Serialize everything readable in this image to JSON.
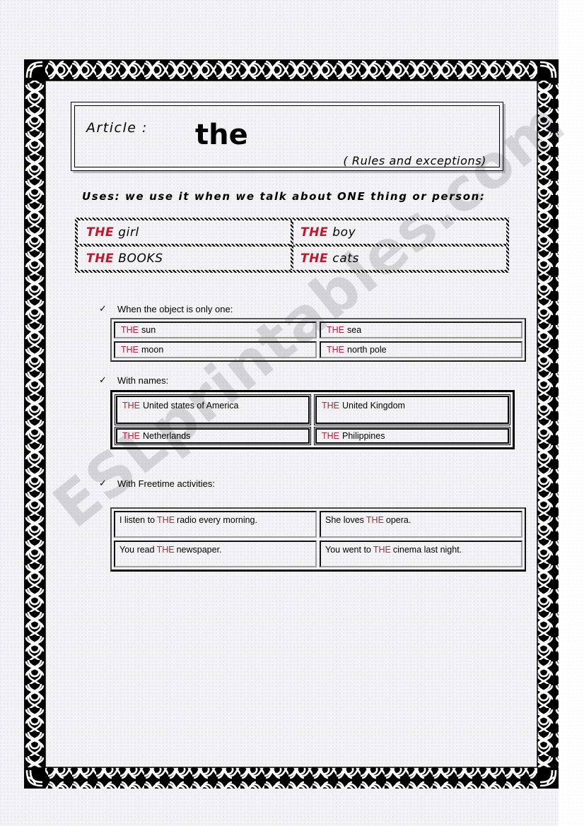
{
  "watermark": {
    "text": "ESLprintables.com"
  },
  "title": {
    "article_label": "Article :",
    "word": "the",
    "subtitle": "( Rules and exceptions)"
  },
  "uses": {
    "line": "Uses: we use it when we talk about ONE thing or person:"
  },
  "colors": {
    "the_red": "#c0172c",
    "the_red_small": "#b3253c",
    "page_background": "#f3f3f5",
    "frame_black": "#000000"
  },
  "icons": {
    "bullet": "check-icon",
    "bullet_glyph": "✓"
  },
  "examples_table": {
    "rows": [
      [
        {
          "the": "THE",
          "word": "girl"
        },
        {
          "the": "THE",
          "word": "boy"
        }
      ],
      [
        {
          "the": "THE",
          "word": "BOOKS"
        },
        {
          "the": "THE",
          "word": "cats"
        }
      ]
    ]
  },
  "sections": [
    {
      "label": "When the object is only one:",
      "rows": [
        [
          {
            "the": "THE",
            "word": "sun"
          },
          {
            "the": "THE",
            "word": "sea"
          }
        ],
        [
          {
            "the": "THE",
            "word": "moon"
          },
          {
            "the": "THE",
            "word": "north pole"
          }
        ]
      ]
    },
    {
      "label": "With names:",
      "rows": [
        [
          {
            "the": "THE",
            "word": "United states of America"
          },
          {
            "the": "THE",
            "word": "United Kingdom"
          }
        ],
        [
          {
            "the": "THE",
            "word": "Netherlands"
          },
          {
            "the": "THE",
            "word": "Philippines"
          }
        ]
      ]
    },
    {
      "label": "With Freetime activities:",
      "rows": [
        [
          {
            "before": "I listen to ",
            "the": "THE",
            "after": " radio every morning."
          },
          {
            "before": "She loves ",
            "the": "THE",
            "after": " opera."
          }
        ],
        [
          {
            "before": "You read ",
            "the": "THE",
            "after": " newspaper."
          },
          {
            "before": "You went to ",
            "the": "THE",
            "after": " cinema last night."
          }
        ]
      ]
    }
  ]
}
